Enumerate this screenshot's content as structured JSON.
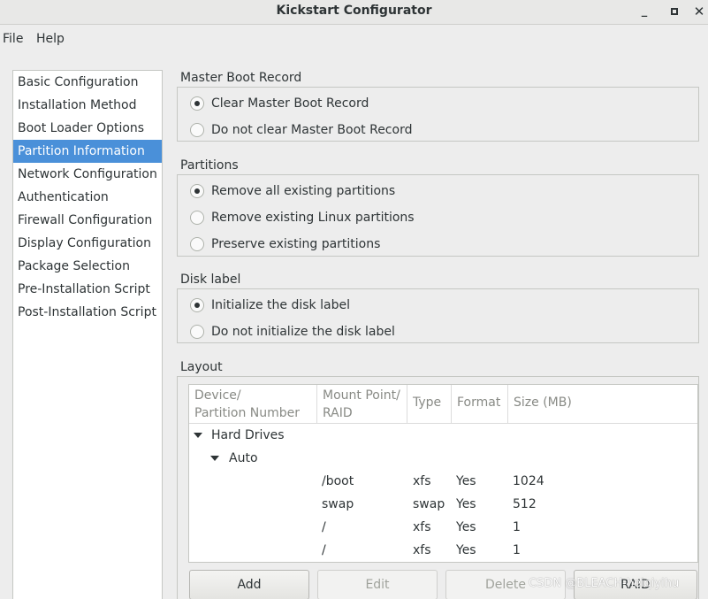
{
  "window": {
    "title": "Kickstart Configurator",
    "minimize_icon": "minimize-icon",
    "maximize_icon": "maximize-icon",
    "close_icon": "close-icon"
  },
  "menubar": {
    "items": [
      "File",
      "Help"
    ]
  },
  "sidebar": {
    "items": [
      "Basic Configuration",
      "Installation Method",
      "Boot Loader Options",
      "Partition Information",
      "Network Configuration",
      "Authentication",
      "Firewall Configuration",
      "Display Configuration",
      "Package Selection",
      "Pre-Installation Script",
      "Post-Installation Script"
    ],
    "selected": "Partition Information",
    "selected_color": "#4a90d9"
  },
  "mbr": {
    "title": "Master Boot Record",
    "options": [
      "Clear Master Boot Record",
      "Do not clear Master Boot Record"
    ],
    "selected": "Clear Master Boot Record"
  },
  "partitions": {
    "title": "Partitions",
    "options": [
      "Remove all existing partitions",
      "Remove existing Linux partitions",
      "Preserve existing partitions"
    ],
    "selected": "Remove all existing partitions"
  },
  "disklabel": {
    "title": "Disk label",
    "options": [
      "Initialize the disk label",
      "Do not initialize the disk label"
    ],
    "selected": "Initialize the disk label"
  },
  "layout": {
    "title": "Layout",
    "columns": {
      "device_line1": "Device/",
      "device_line2": "Partition Number",
      "mount_line1": "Mount Point/",
      "mount_line2": "RAID",
      "type": "Type",
      "format": "Format",
      "size": "Size (MB)"
    },
    "tree": {
      "root": "Hard Drives",
      "child": "Auto"
    },
    "rows": [
      {
        "mount": "/boot",
        "type": "xfs",
        "format": "Yes",
        "size": "1024"
      },
      {
        "mount": "swap",
        "type": "swap",
        "format": "Yes",
        "size": "512"
      },
      {
        "mount": "/",
        "type": "xfs",
        "format": "Yes",
        "size": "1"
      },
      {
        "mount": "/",
        "type": "xfs",
        "format": "Yes",
        "size": "1"
      }
    ]
  },
  "buttons": {
    "add": "Add",
    "edit": "Edit",
    "delete": "Delete",
    "raid": "RAID"
  },
  "watermark": "CSDN @BLEACH-heiqiyihu"
}
